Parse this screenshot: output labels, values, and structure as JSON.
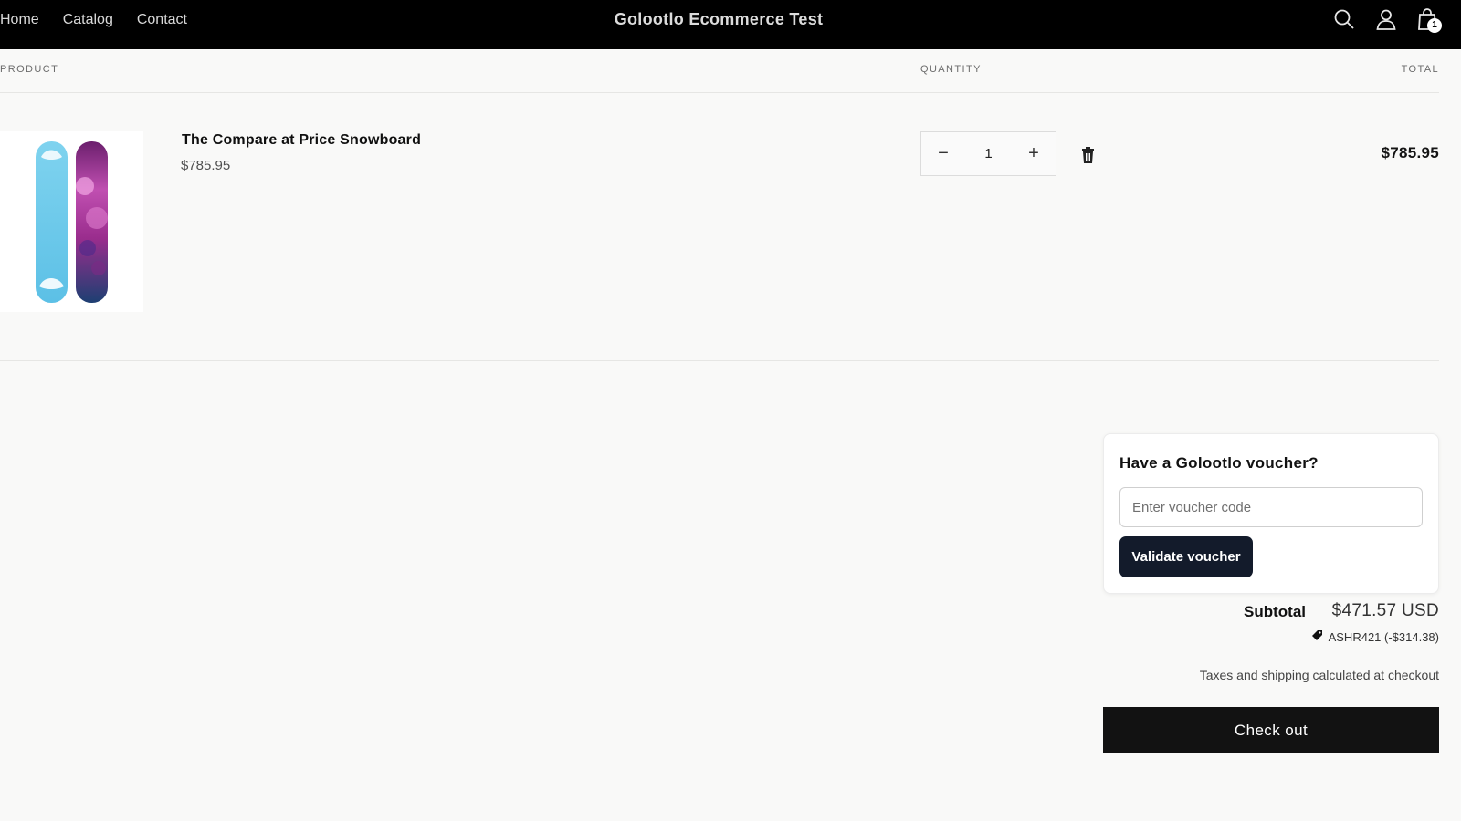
{
  "header": {
    "nav": [
      "Home",
      "Catalog",
      "Contact"
    ],
    "brand": "Golootlo Ecommerce Test",
    "icons": [
      "search-icon",
      "account-icon",
      "cart-icon"
    ],
    "cart_count": "1"
  },
  "table": {
    "col_product": "PRODUCT",
    "col_quantity": "QUANTITY",
    "col_total": "TOTAL"
  },
  "item": {
    "name": "The Compare at Price Snowboard",
    "price": "$785.95",
    "quantity": "1",
    "total": "$785.95",
    "minus": "−",
    "plus": "+"
  },
  "voucher": {
    "title": "Have a Golootlo voucher?",
    "placeholder": "Enter voucher code",
    "value": "",
    "button": "Validate voucher"
  },
  "summary": {
    "subtotal_label": "Subtotal",
    "subtotal_value": "$471.57 USD",
    "discount": "ASHR421 (-$314.38)",
    "taxes_note": "Taxes and shipping calculated at checkout",
    "checkout": "Check out"
  },
  "colors": {
    "header_bg": "#000000",
    "page_bg": "#f9f9f8",
    "voucher_button": "#131b2b",
    "checkout_button": "#121212"
  }
}
